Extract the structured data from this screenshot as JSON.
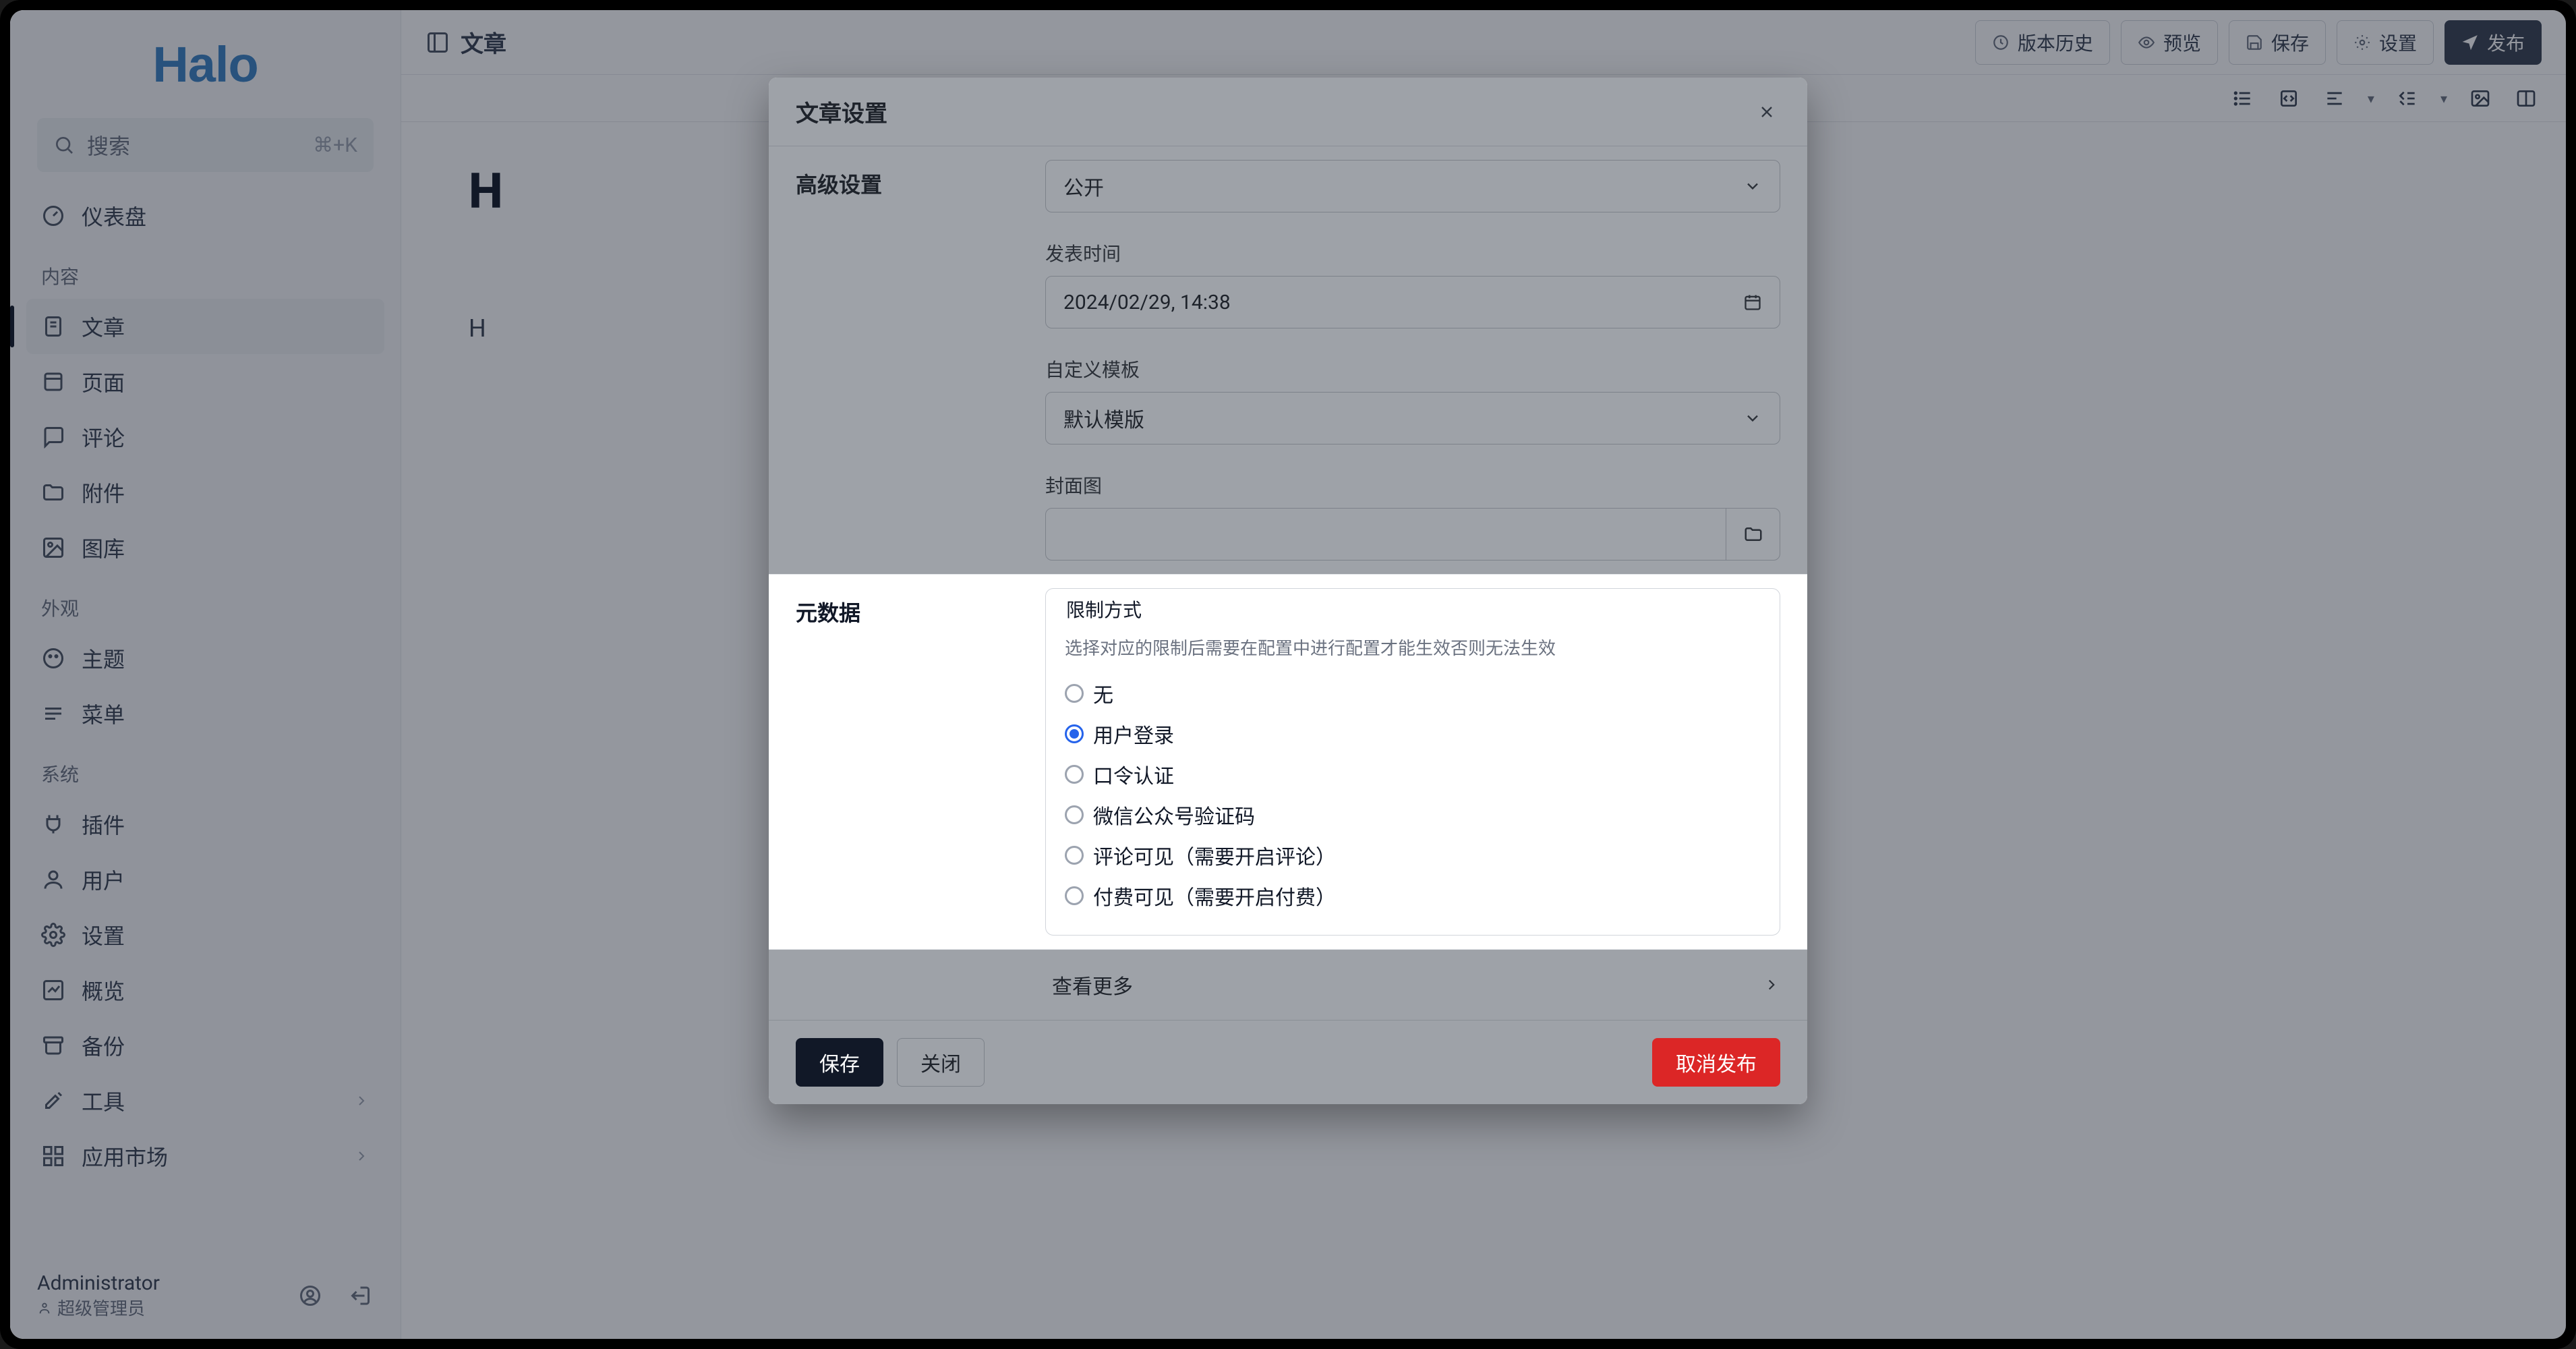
{
  "brand": "Halo",
  "search": {
    "placeholder": "搜索",
    "kbd": "⌘+K"
  },
  "sidebar": {
    "top_item": {
      "label": "仪表盘"
    },
    "groups": [
      {
        "label": "内容",
        "items": [
          {
            "label": "文章",
            "active": true
          },
          {
            "label": "页面"
          },
          {
            "label": "评论"
          },
          {
            "label": "附件"
          },
          {
            "label": "图库"
          }
        ]
      },
      {
        "label": "外观",
        "items": [
          {
            "label": "主题"
          },
          {
            "label": "菜单"
          }
        ]
      },
      {
        "label": "系统",
        "items": [
          {
            "label": "插件"
          },
          {
            "label": "用户"
          },
          {
            "label": "设置"
          },
          {
            "label": "概览"
          },
          {
            "label": "备份"
          },
          {
            "label": "工具",
            "chev": true
          },
          {
            "label": "应用市场",
            "chev": true
          }
        ]
      }
    ]
  },
  "footer": {
    "name": "Administrator",
    "role": "超级管理员"
  },
  "header": {
    "breadcrumb": "文章",
    "buttons": {
      "history": "版本历史",
      "preview": "预览",
      "save": "保存",
      "settings": "设置",
      "publish": "发布"
    }
  },
  "editor": {
    "title": "H",
    "line1": "H"
  },
  "modal": {
    "title": "文章设置",
    "advanced_label": "高级设置",
    "visibility": {
      "value": "公开"
    },
    "publish_time": {
      "label": "发表时间",
      "value": "2024/02/29, 14:38"
    },
    "template": {
      "label": "自定义模板",
      "value": "默认模版"
    },
    "cover": {
      "label": "封面图",
      "value": ""
    },
    "meta_label": "元数据",
    "restrict": {
      "legend": "限制方式",
      "hint": "选择对应的限制后需要在配置中进行配置才能生效否则无法生效",
      "options": [
        "无",
        "用户登录",
        "口令认证",
        "微信公众号验证码",
        "评论可见（需要开启评论）",
        "付费可见（需要开启付费）"
      ],
      "selected_index": 1
    },
    "see_more": "查看更多",
    "buttons": {
      "save": "保存",
      "close": "关闭",
      "unpublish": "取消发布"
    }
  }
}
